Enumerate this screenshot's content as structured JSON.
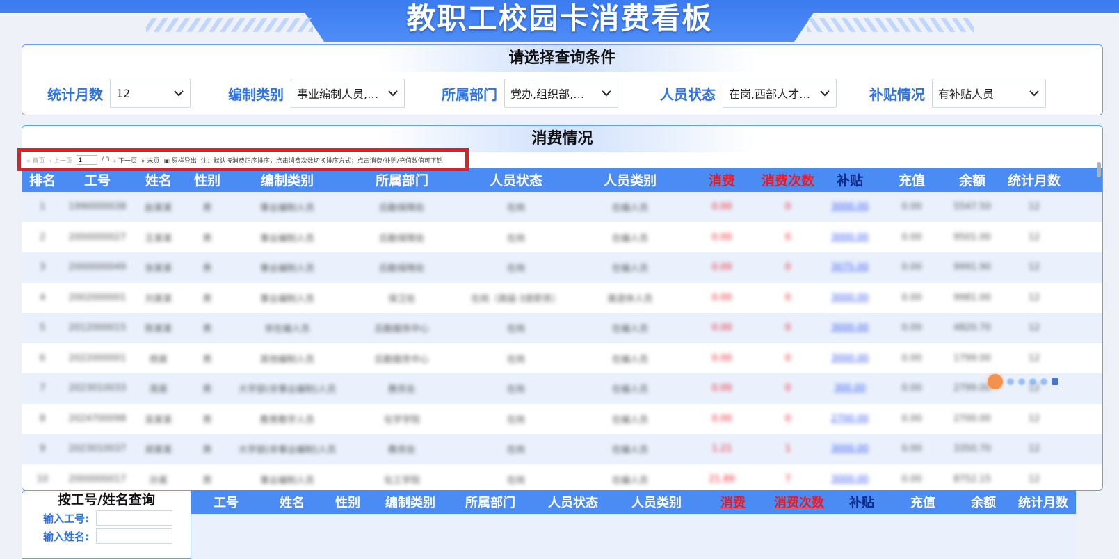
{
  "header": {
    "title": "教职工校园卡消费看板"
  },
  "filters": {
    "title": "请选择查询条件",
    "items": [
      {
        "label": "统计月数",
        "value": "12"
      },
      {
        "label": "编制类别",
        "value": "事业编制人员,…"
      },
      {
        "label": "所属部门",
        "value": "党办,组织部,宣…"
      },
      {
        "label": "人员状态",
        "value": "在岗,西部人才,…"
      },
      {
        "label": "补贴情况",
        "value": "有补贴人员"
      }
    ]
  },
  "consume": {
    "title": "消费情况",
    "toolbar": {
      "first": "首页",
      "prev": "上一页",
      "page": "1",
      "total": "/ 3",
      "next": "下一页",
      "last": "末页",
      "export": "原样导出",
      "note": "注：默认按消费正序排序，点击消费次数切换排序方式；点击消费/补贴/充值数值可下钻"
    },
    "columns": [
      "排名",
      "工号",
      "姓名",
      "性别",
      "编制类别",
      "所属部门",
      "人员状态",
      "人员类别",
      "消费",
      "消费次数",
      "补贴",
      "充值",
      "余额",
      "统计月数"
    ],
    "rows": [
      [
        "1",
        "1990000038",
        "赵某某",
        "男",
        "事业编制人员",
        "后勤保障处",
        "在岗",
        "在编人员",
        "0.00",
        "0",
        "3000.00",
        "0.00",
        "5547.50",
        "12"
      ],
      [
        "2",
        "2000000027",
        "王某某",
        "男",
        "事业编制人员",
        "后勤保障处",
        "在岗",
        "在编人员",
        "0.00",
        "0",
        "3000.00",
        "0.00",
        "9501.00",
        "12"
      ],
      [
        "3",
        "2000000049",
        "张某某",
        "男",
        "事业编制人员",
        "后勤保障处",
        "在岗",
        "在编人员",
        "0.00",
        "0",
        "3075.00",
        "0.00",
        "9991.90",
        "12"
      ],
      [
        "4",
        "2002000001",
        "刘某某",
        "男",
        "事业编制人员",
        "保卫处",
        "在岗（高级·3类职务）",
        "离退休人员",
        "0.00",
        "0",
        "3000.00",
        "0.00",
        "9981.00",
        "12"
      ],
      [
        "5",
        "2012000015",
        "陈某某",
        "男",
        "非在编人员",
        "后勤服务中心",
        "在岗",
        "在编人员",
        "0.00",
        "0",
        "3000.00",
        "0.00",
        "4820.70",
        "12"
      ],
      [
        "6",
        "2022000001",
        "杨某",
        "男",
        "其他编制人员",
        "后勤服务中心",
        "在岗",
        "在编人员",
        "0.00",
        "0",
        "3000.00",
        "0.00",
        "1799.00",
        "12"
      ],
      [
        "7",
        "2023010033",
        "周某",
        "男",
        "大学部(非事业编制)人员",
        "教务处",
        "在岗",
        "在编人员",
        "0.00",
        "0",
        "300.00",
        "0.00",
        "2799.00",
        "12"
      ],
      [
        "8",
        "2024700098",
        "吴某某",
        "男",
        "教育教学人员",
        "化学学院",
        "在岗",
        "在编人员",
        "0.00",
        "0",
        "2700.00",
        "0.00",
        "2700.00",
        "12"
      ],
      [
        "9",
        "2023010037",
        "郑某某",
        "男",
        "大学部(非事业编制)人员",
        "教务处",
        "在岗",
        "在编人员",
        "1.21",
        "1",
        "3000.00",
        "0.00",
        "3350.70",
        "12"
      ],
      [
        "10",
        "2000000017",
        "孙某",
        "男",
        "事业编制人员",
        "化工学院",
        "在岗",
        "在编人员",
        "21.89",
        "7",
        "3000.00",
        "0.00",
        "8752.15",
        "12"
      ]
    ]
  },
  "query": {
    "title": "按工号/姓名查询",
    "id_label": "输入工号:",
    "name_label": "输入姓名:"
  },
  "bottom_columns": [
    "工号",
    "姓名",
    "性别",
    "编制类别",
    "所属部门",
    "人员状态",
    "人员类别",
    "消费",
    "消费次数",
    "补贴",
    "充值",
    "余额",
    "统计月数"
  ]
}
